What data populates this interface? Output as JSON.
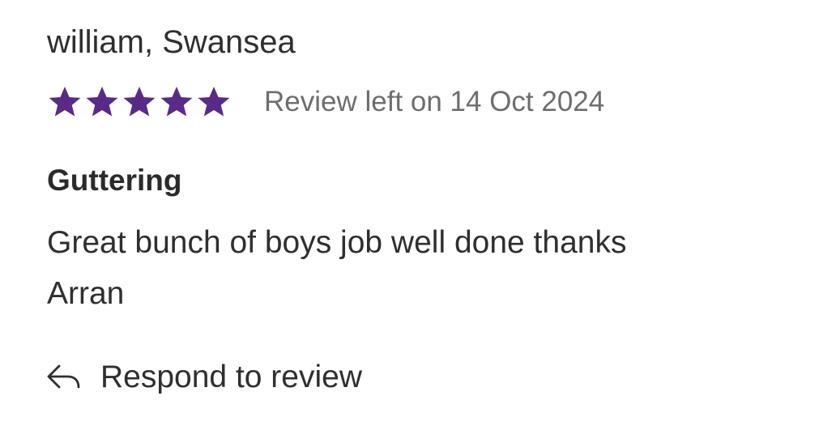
{
  "review": {
    "reviewer": "william, Swansea",
    "rating": 5,
    "rating_max": 5,
    "star_icon": "star-icon",
    "star_color": "#5b2a86",
    "date_text": "Review left on 14 Oct 2024",
    "title": "Guttering",
    "body_lines": [
      "Great bunch of boys job well done thanks",
      "Arran"
    ]
  },
  "actions": {
    "respond_icon": "reply-icon",
    "respond_label": "Respond to review"
  }
}
